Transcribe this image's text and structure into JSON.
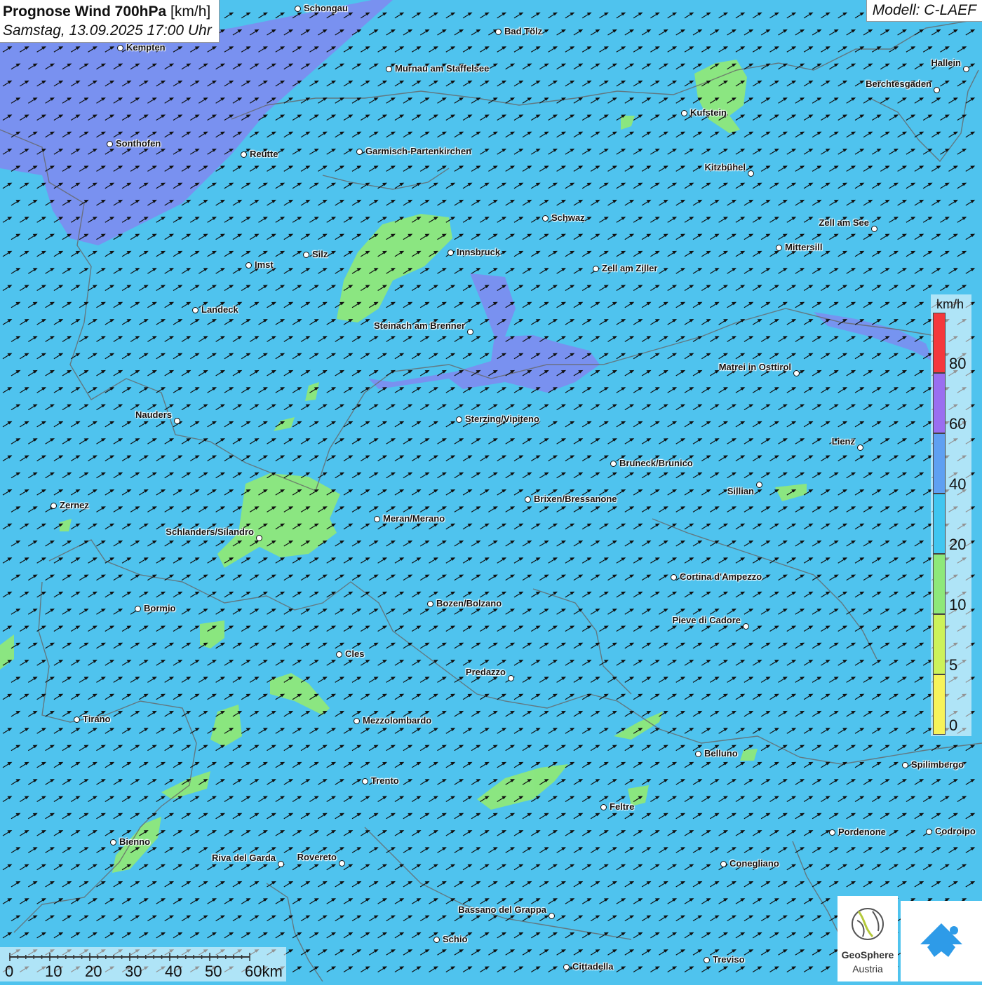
{
  "header": {
    "title_bold": "Prognose Wind 700hPa",
    "title_unit": "[km/h]",
    "subtitle": "Samstag, 13.09.2025 17:00 Uhr",
    "model": "Modell: C-LAEF"
  },
  "legend": {
    "unit": "km/h",
    "ticks": [
      "0",
      "5",
      "10",
      "20",
      "40",
      "60",
      "80"
    ],
    "colors": [
      "#f7f35a",
      "#cdf25a",
      "#8ee87a",
      "#41c6f0",
      "#5fa0f2",
      "#9a6ef0",
      "#f4383c"
    ]
  },
  "scale": {
    "labels": [
      "0",
      "10",
      "20",
      "30",
      "40",
      "50",
      "60km"
    ]
  },
  "logos": {
    "geosphere_name": "GeoSphere",
    "geosphere_sub": "Austria"
  },
  "cities": [
    {
      "name": "Schongau"
    },
    {
      "name": "Kempten"
    },
    {
      "name": "Bad Tölz"
    },
    {
      "name": "Murnau am Staffelsee"
    },
    {
      "name": "Hallein"
    },
    {
      "name": "Berchtesgaden"
    },
    {
      "name": "Kufstein"
    },
    {
      "name": "Sonthofen"
    },
    {
      "name": "Reutte"
    },
    {
      "name": "Garmisch-Partenkirchen"
    },
    {
      "name": "Kitzbühel"
    },
    {
      "name": "Schwaz"
    },
    {
      "name": "Zell am See"
    },
    {
      "name": "Innsbruck"
    },
    {
      "name": "Mittersill"
    },
    {
      "name": "Silz"
    },
    {
      "name": "Imst"
    },
    {
      "name": "Zell am Ziller"
    },
    {
      "name": "Landeck"
    },
    {
      "name": "Steinach am Brenner"
    },
    {
      "name": "Matrei in Osttirol"
    },
    {
      "name": "Nauders"
    },
    {
      "name": "Sterzing/Vipiteno"
    },
    {
      "name": "Lienz"
    },
    {
      "name": "Bruneck/Brunico"
    },
    {
      "name": "Sillian"
    },
    {
      "name": "Brixen/Bressanone"
    },
    {
      "name": "Zernez"
    },
    {
      "name": "Meran/Merano"
    },
    {
      "name": "Schlanders/Silandro"
    },
    {
      "name": "Cortina d'Ampezzo"
    },
    {
      "name": "Bozen/Bolzano"
    },
    {
      "name": "Bormio"
    },
    {
      "name": "Pieve di Cadore"
    },
    {
      "name": "Cles"
    },
    {
      "name": "Predazzo"
    },
    {
      "name": "Tirano"
    },
    {
      "name": "Mezzolombardo"
    },
    {
      "name": "Belluno"
    },
    {
      "name": "Spilimbergo"
    },
    {
      "name": "Trento"
    },
    {
      "name": "Feltre"
    },
    {
      "name": "Pordenone"
    },
    {
      "name": "Codroipo"
    },
    {
      "name": "Bienno"
    },
    {
      "name": "Riva del Garda"
    },
    {
      "name": "Rovereto"
    },
    {
      "name": "Conegliano"
    },
    {
      "name": "Bassano del Grappa"
    },
    {
      "name": "Schio"
    },
    {
      "name": "Treviso"
    },
    {
      "name": "Cittadella"
    }
  ]
}
